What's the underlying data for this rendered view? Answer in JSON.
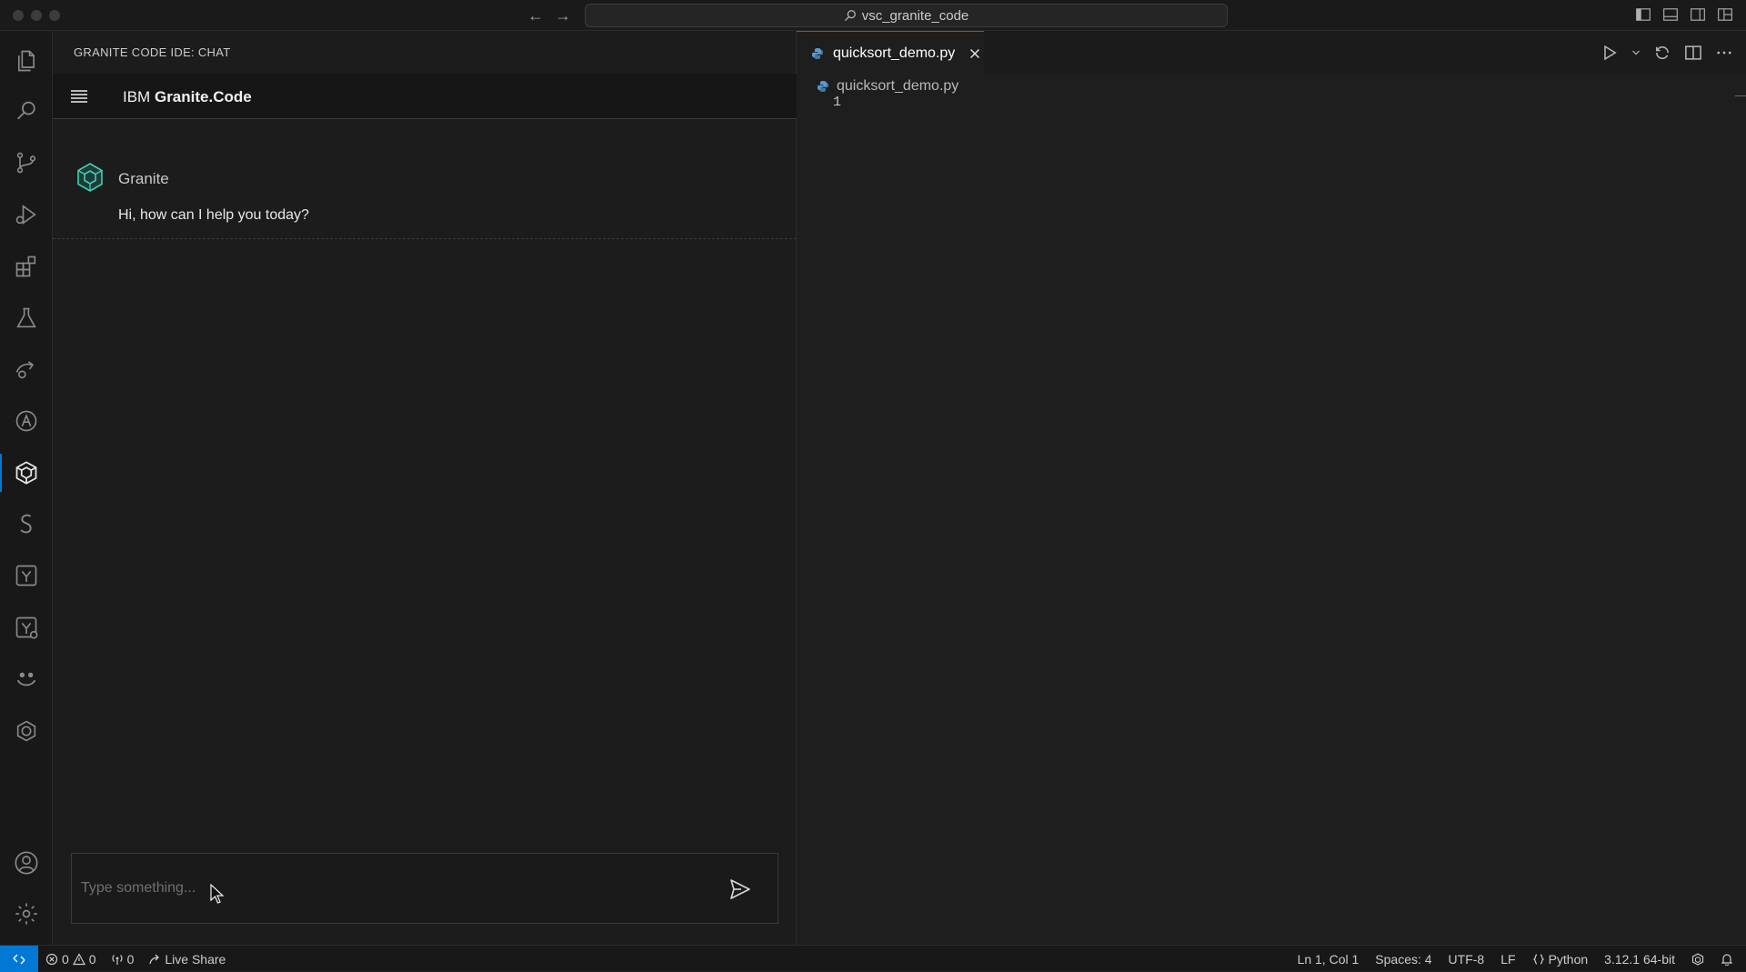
{
  "window": {
    "search_text": "vsc_granite_code"
  },
  "chat_panel": {
    "title": "GRANITE CODE IDE: CHAT",
    "brand_prefix": "IBM",
    "brand_name": "Granite.Code",
    "messages": [
      {
        "author": "Granite",
        "text": "Hi, how can I help you today?"
      }
    ],
    "input": {
      "placeholder": "Type something...",
      "value": ""
    }
  },
  "editor": {
    "tab_label": "quicksort_demo.py",
    "breadcrumb_file": "quicksort_demo.py",
    "line_numbers": [
      "1"
    ]
  },
  "status_bar": {
    "errors": "0",
    "warnings": "0",
    "ports": "0",
    "live_share": "Live Share",
    "position": "Ln 1, Col 1",
    "spaces": "Spaces: 4",
    "encoding": "UTF-8",
    "eol": "LF",
    "language": "Python",
    "interpreter": "3.12.1 64-bit"
  },
  "icons": {
    "activity_bar": [
      "files-icon",
      "search-icon",
      "source-control-icon",
      "run-debug-icon",
      "extensions-icon",
      "testing-icon",
      "remote-explorer-icon",
      "astro-icon",
      "granite-icon",
      "snyk-icon",
      "yaml-icon",
      "yaml-check-icon",
      "mascot-icon",
      "openshift-icon",
      "account-icon",
      "settings-gear-icon"
    ]
  },
  "colors": {
    "accent": "#0078d4",
    "granite_teal": "#3fd0b7",
    "python_blue": "#5b9bd5"
  }
}
